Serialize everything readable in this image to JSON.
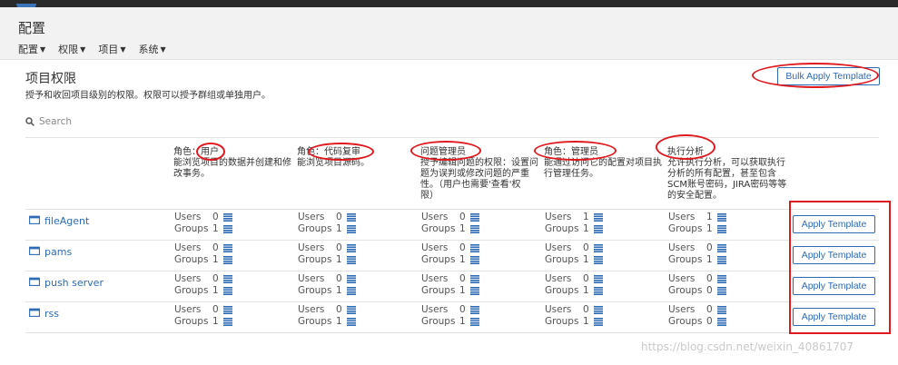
{
  "header": {
    "title": "配置",
    "menu": [
      {
        "label": "配置",
        "icon": "chevron-down-icon"
      },
      {
        "label": "权限",
        "icon": "chevron-down-icon"
      },
      {
        "label": "项目",
        "icon": "chevron-down-icon"
      },
      {
        "label": "系统",
        "icon": "chevron-down-icon"
      }
    ]
  },
  "page": {
    "title": "项目权限",
    "description": "授予和收回项目级别的权限。权限可以授予群组或单独用户。",
    "bulk_button": "Bulk Apply Template",
    "search_placeholder": "Search"
  },
  "columns": [
    {
      "title": "角色：用户",
      "desc": [
        "能浏览项目的数据并创建和修",
        "改事务。"
      ]
    },
    {
      "title": "角色：代码复审",
      "desc": [
        "能浏览项目源码。"
      ]
    },
    {
      "title": "问题管理员",
      "desc": [
        "授予编辑问题的权限：设置问",
        "题为误判或修改问题的严重",
        "性。（用户也需要'查看'权",
        "限）"
      ]
    },
    {
      "title": "角色：管理员",
      "desc": [
        "能通过访问它的配置对项目执",
        "行管理任务。"
      ]
    },
    {
      "title": "执行分析",
      "desc": [
        "允许执行分析，可以获取执行",
        "分析的所有配置，甚至包含",
        "SCM账号密码，JIRA密码等等",
        "的安全配置。"
      ]
    }
  ],
  "labels": {
    "users": "Users",
    "groups": "Groups",
    "apply": "Apply Template"
  },
  "projects": [
    {
      "name": "fileAgent",
      "perms": [
        [
          0,
          1
        ],
        [
          0,
          1
        ],
        [
          0,
          1
        ],
        [
          1,
          1
        ],
        [
          1,
          1
        ]
      ]
    },
    {
      "name": "pams",
      "perms": [
        [
          0,
          1
        ],
        [
          0,
          1
        ],
        [
          0,
          1
        ],
        [
          0,
          1
        ],
        [
          0,
          1
        ]
      ]
    },
    {
      "name": "push server",
      "perms": [
        [
          0,
          1
        ],
        [
          0,
          1
        ],
        [
          0,
          1
        ],
        [
          0,
          1
        ],
        [
          0,
          0
        ]
      ]
    },
    {
      "name": "rss",
      "perms": [
        [
          0,
          1
        ],
        [
          0,
          1
        ],
        [
          0,
          1
        ],
        [
          0,
          1
        ],
        [
          0,
          0
        ]
      ]
    }
  ],
  "watermark": "https://blog.csdn.net/weixin_40861707",
  "colors": {
    "accent": "#2f6bb4",
    "annotation": "#e0191f",
    "header_bg": "#f2f2f2"
  }
}
